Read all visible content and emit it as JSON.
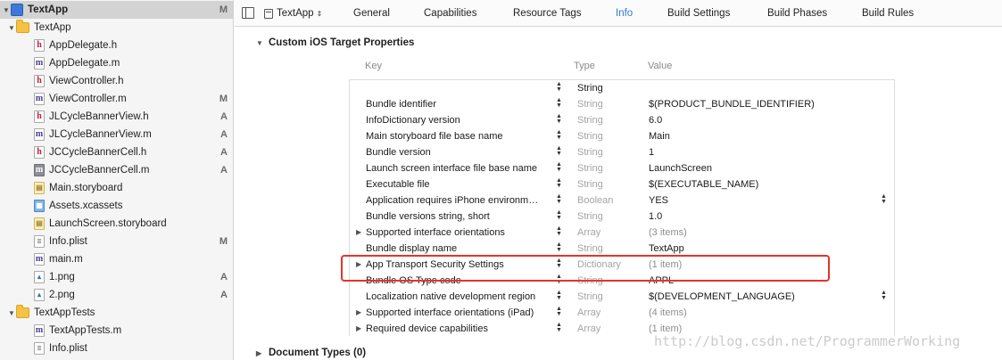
{
  "navigator": {
    "items": [
      {
        "label": "TextApp",
        "icon": "project-icon",
        "status": "M",
        "indent": 0,
        "disclosure": "▼",
        "selected": true
      },
      {
        "label": "TextApp",
        "icon": "folder-icon",
        "status": "",
        "indent": 1,
        "disclosure": "▼"
      },
      {
        "label": "AppDelegate.h",
        "icon": "header-file-icon",
        "status": "",
        "indent": 2
      },
      {
        "label": "AppDelegate.m",
        "icon": "source-file-icon",
        "status": "",
        "indent": 2
      },
      {
        "label": "ViewController.h",
        "icon": "header-file-icon",
        "status": "",
        "indent": 2
      },
      {
        "label": "ViewController.m",
        "icon": "source-file-icon",
        "status": "M",
        "indent": 2
      },
      {
        "label": "JLCycleBannerView.h",
        "icon": "header-file-icon",
        "status": "A",
        "indent": 2
      },
      {
        "label": "JLCycleBannerView.m",
        "icon": "source-file-icon",
        "status": "A",
        "indent": 2
      },
      {
        "label": "JCCycleBannerCell.h",
        "icon": "header-file-icon",
        "status": "A",
        "indent": 2
      },
      {
        "label": "JCCycleBannerCell.m",
        "icon": "source-file-gray-icon",
        "status": "A",
        "indent": 2
      },
      {
        "label": "Main.storyboard",
        "icon": "storyboard-icon",
        "status": "",
        "indent": 2
      },
      {
        "label": "Assets.xcassets",
        "icon": "assets-icon",
        "status": "",
        "indent": 2
      },
      {
        "label": "LaunchScreen.storyboard",
        "icon": "storyboard-icon",
        "status": "",
        "indent": 2
      },
      {
        "label": "Info.plist",
        "icon": "plist-icon",
        "status": "M",
        "indent": 2
      },
      {
        "label": "main.m",
        "icon": "source-file-icon",
        "status": "",
        "indent": 2
      },
      {
        "label": "1.png",
        "icon": "image-file-icon",
        "status": "A",
        "indent": 2
      },
      {
        "label": "2.png",
        "icon": "image-file-icon",
        "status": "A",
        "indent": 2
      },
      {
        "label": "TextAppTests",
        "icon": "folder-icon",
        "status": "",
        "indent": 1,
        "disclosure": "▼"
      },
      {
        "label": "TextAppTests.m",
        "icon": "source-file-icon",
        "status": "",
        "indent": 2
      },
      {
        "label": "Info.plist",
        "icon": "plist-icon",
        "status": "",
        "indent": 2
      }
    ]
  },
  "tabbar": {
    "target": "TextApp",
    "tabs": [
      {
        "label": "General",
        "active": false
      },
      {
        "label": "Capabilities",
        "active": false
      },
      {
        "label": "Resource Tags",
        "active": false
      },
      {
        "label": "Info",
        "active": true
      },
      {
        "label": "Build Settings",
        "active": false
      },
      {
        "label": "Build Phases",
        "active": false
      },
      {
        "label": "Build Rules",
        "active": false
      }
    ]
  },
  "section": {
    "title": "Custom iOS Target Properties",
    "next_title": "Document Types (0)"
  },
  "table": {
    "columns": {
      "key": "Key",
      "type": "Type",
      "value": "Value"
    },
    "rows": [
      {
        "key": "",
        "type": "String",
        "value": "",
        "type_dark": true,
        "disclosure": false,
        "value_stepper": false
      },
      {
        "key": "Bundle identifier",
        "type": "String",
        "value": "$(PRODUCT_BUNDLE_IDENTIFIER)",
        "disclosure": false,
        "value_stepper": false
      },
      {
        "key": "InfoDictionary version",
        "type": "String",
        "value": "6.0",
        "disclosure": false,
        "value_stepper": false
      },
      {
        "key": "Main storyboard file base name",
        "type": "String",
        "value": "Main",
        "disclosure": false,
        "value_stepper": false
      },
      {
        "key": "Bundle version",
        "type": "String",
        "value": "1",
        "disclosure": false,
        "value_stepper": false
      },
      {
        "key": "Launch screen interface file base name",
        "type": "String",
        "value": "LaunchScreen",
        "disclosure": false,
        "value_stepper": false
      },
      {
        "key": "Executable file",
        "type": "String",
        "value": "$(EXECUTABLE_NAME)",
        "disclosure": false,
        "value_stepper": false
      },
      {
        "key": "Application requires iPhone environm…",
        "type": "Boolean",
        "value": "YES",
        "disclosure": false,
        "value_stepper": true
      },
      {
        "key": "Bundle versions string, short",
        "type": "String",
        "value": "1.0",
        "disclosure": false,
        "value_stepper": false
      },
      {
        "key": "Supported interface orientations",
        "type": "Array",
        "value": "(3 items)",
        "disclosure": true,
        "value_muted": true,
        "value_stepper": false
      },
      {
        "key": "Bundle display name",
        "type": "String",
        "value": "TextApp",
        "disclosure": false,
        "value_stepper": false
      },
      {
        "key": "App Transport Security Settings",
        "type": "Dictionary",
        "value": "(1 item)",
        "disclosure": true,
        "value_muted": true,
        "value_stepper": false
      },
      {
        "key": "Bundle OS Type code",
        "type": "String",
        "value": "APPL",
        "disclosure": false,
        "value_stepper": false
      },
      {
        "key": "Localization native development region",
        "type": "String",
        "value": "$(DEVELOPMENT_LANGUAGE)",
        "disclosure": false,
        "value_stepper": true
      },
      {
        "key": "Supported interface orientations (iPad)",
        "type": "Array",
        "value": "(4 items)",
        "disclosure": true,
        "value_muted": true,
        "value_stepper": false
      },
      {
        "key": "Required device capabilities",
        "type": "Array",
        "value": "(1 item)",
        "disclosure": true,
        "value_muted": true,
        "value_stepper": false
      }
    ]
  },
  "highlight_color": "#e2352b",
  "accent_color": "#2f7bd6",
  "watermark": "http://blog.csdn.net/ProgrammerWorking"
}
